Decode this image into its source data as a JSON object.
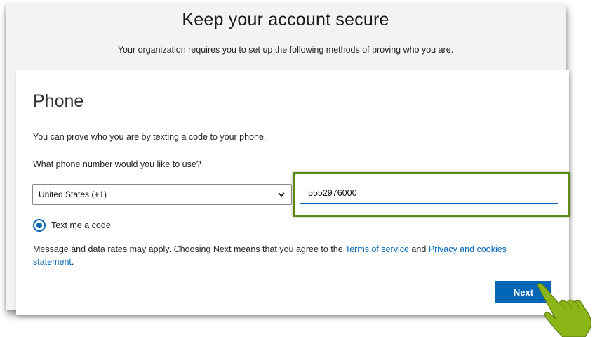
{
  "header": {
    "title": "Keep your account secure",
    "subtitle": "Your organization requires you to set up the following methods of proving who you are."
  },
  "card": {
    "heading": "Phone",
    "intro": "You can prove who you are by texting a code to your phone.",
    "question": "What phone number would you like to use?",
    "country_select": {
      "selected": "United States (+1)"
    },
    "phone_input": {
      "value": "5552976000"
    },
    "radio": {
      "label": "Text me a code",
      "checked": true
    },
    "disclaimer": {
      "prefix": "Message and data rates may apply. Choosing Next means that you agree to the ",
      "terms_link": "Terms of service",
      "middle": " and ",
      "privacy_link": "Privacy and cookies statement",
      "suffix": "."
    },
    "next_label": "Next"
  },
  "colors": {
    "accent": "#0067b8",
    "highlight": "#5c8a0a",
    "cursor": "#8cb518"
  },
  "icons": {
    "select_chevron": "chevron-down-icon",
    "pointer": "hand-pointer-icon"
  }
}
